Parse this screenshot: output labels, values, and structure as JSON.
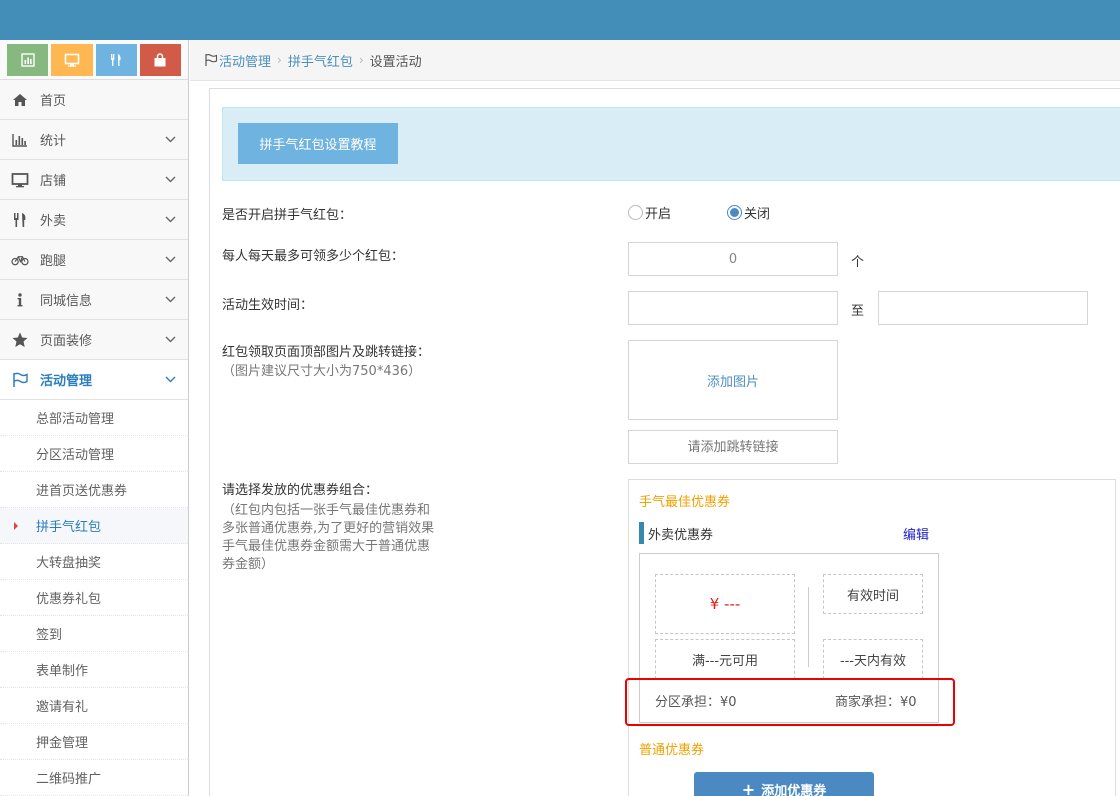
{
  "sidebar": {
    "shortcuts": [
      {
        "icon": "bar-chart-icon",
        "color": "#87b87f"
      },
      {
        "icon": "monitor-icon",
        "color": "#ffb752"
      },
      {
        "icon": "utensils-icon",
        "color": "#6fb3e0"
      },
      {
        "icon": "shopping-bag-icon",
        "color": "#d15b47"
      }
    ],
    "menu": [
      {
        "label": "首页",
        "icon": "home-icon"
      },
      {
        "label": "统计",
        "icon": "bar-chart-icon"
      },
      {
        "label": "店铺",
        "icon": "desktop-icon"
      },
      {
        "label": "外卖",
        "icon": "utensils-icon"
      },
      {
        "label": "跑腿",
        "icon": "bicycle-icon"
      },
      {
        "label": "同城信息",
        "icon": "info-icon"
      },
      {
        "label": "页面装修",
        "icon": "star-icon"
      },
      {
        "label": "活动管理",
        "icon": "flag-icon"
      }
    ],
    "submenu": [
      "总部活动管理",
      "分区活动管理",
      "进首页送优惠券",
      "拼手气红包",
      "大转盘抽奖",
      "优惠券礼包",
      "签到",
      "表单制作",
      "邀请有礼",
      "押金管理",
      "二维码推广"
    ]
  },
  "breadcrumb": {
    "items": [
      "活动管理",
      "拼手气红包",
      "设置活动"
    ]
  },
  "main": {
    "tutorial_button": "拼手气红包设置教程",
    "enable": {
      "label": "是否开启拼手气红包：",
      "options": [
        "开启",
        "关闭"
      ],
      "selected": "关闭"
    },
    "max_per_day": {
      "label": "每人每天最多可领多少个红包：",
      "value": "0",
      "unit": "个"
    },
    "effective_time": {
      "label": "活动生效时间：",
      "separator": "至"
    },
    "header_image": {
      "label": "红包领取页面顶部图片及跳转链接：",
      "hint": "（图片建议尺寸大小为750*436）",
      "add_image": "添加图片",
      "link_placeholder": "请添加跳转链接"
    },
    "coupon_combo": {
      "label": "请选择发放的优惠券组合：",
      "hint_lines": [
        "（红包内包括一张手气最佳优惠券和",
        "多张普通优惠券,为了更好的营销效果",
        "手气最佳优惠券金额需大于普通优惠",
        "券金额）"
      ],
      "best_title": "手气最佳优惠券",
      "coupon_type": "外卖优惠券",
      "edit": "编辑",
      "price": "¥ ---",
      "min_spend": "满---元可用",
      "valid_label": "有效时间",
      "valid_days": "---天内有效",
      "district_share": "分区承担：¥0",
      "merchant_share": "商家承担：¥0",
      "normal_title": "普通优惠券",
      "add_coupon": "添加优惠券"
    }
  },
  "colors": {
    "topbar": "#438eb9",
    "accent": "#4c8fbd",
    "highlight_frame": "#e00000",
    "orange_title": "#f0a000",
    "price": "#e41b17"
  }
}
